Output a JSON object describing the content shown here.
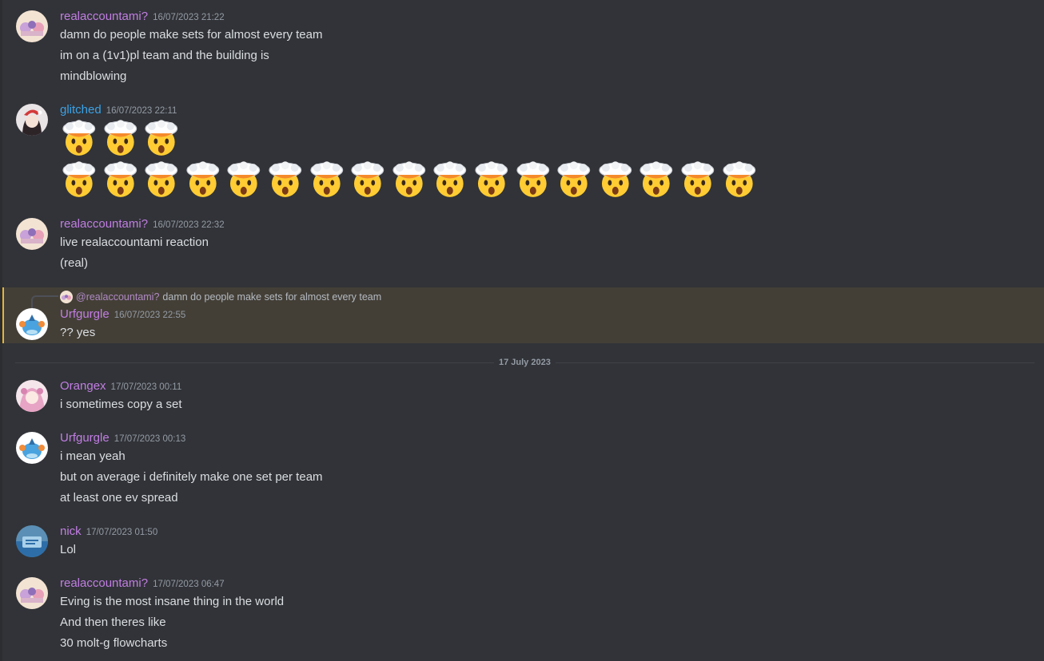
{
  "date_divider": "17 July 2023",
  "messages": [
    {
      "username": "realaccountami?",
      "timestamp": "16/07/2023 21:22",
      "lines": [
        "damn do people make sets for almost every team",
        "im on a (1v1)pl team and the building is",
        "mindblowing"
      ]
    },
    {
      "username": "glitched",
      "timestamp": "16/07/2023 22:11",
      "emoji": "exploding-head",
      "emoji_rows": [
        3,
        17
      ]
    },
    {
      "username": "realaccountami?",
      "timestamp": "16/07/2023 22:32",
      "lines": [
        "live realaccountami reaction",
        "(real)"
      ]
    },
    {
      "username": "Urfgurgle",
      "timestamp": "16/07/2023 22:55",
      "reply": {
        "mention": "@realaccountami?",
        "text": "damn do people make sets for almost every team"
      },
      "lines": [
        "?? yes"
      ]
    },
    {
      "username": "Orangex",
      "timestamp": "17/07/2023 00:11",
      "lines": [
        "i sometimes copy a set"
      ]
    },
    {
      "username": "Urfgurgle",
      "timestamp": "17/07/2023 00:13",
      "lines": [
        "i mean yeah",
        "but on average i definitely make one set per team",
        "at least one ev spread"
      ]
    },
    {
      "username": "nick",
      "timestamp": "17/07/2023 01:50",
      "lines": [
        "Lol"
      ]
    },
    {
      "username": "realaccountami?",
      "timestamp": "17/07/2023 06:47",
      "lines": [
        "Eving is the most insane thing in the world",
        "And then theres like",
        "30 molt-g flowcharts"
      ]
    }
  ],
  "colors": {
    "background": "#313338",
    "username_purple": "#c27ee3",
    "username_blue": "#3ca2e6",
    "mention_highlight": "#433f37",
    "mention_bar": "#e4b53a"
  }
}
